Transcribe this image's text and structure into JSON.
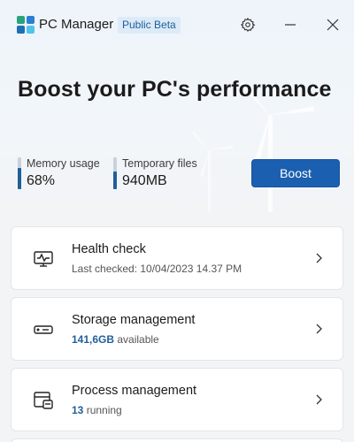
{
  "app": {
    "title": "PC Manager",
    "badge": "Public Beta"
  },
  "titlebar": {
    "settings_icon": "gear-icon",
    "minimize_icon": "minimize-icon",
    "close_icon": "close-icon"
  },
  "hero": {
    "headline": "Boost your PC's performance",
    "memory_label": "Memory usage",
    "memory_value": "68%",
    "memory_level": 0.68,
    "temp_label": "Temporary files",
    "temp_value": "940MB",
    "boost_label": "Boost"
  },
  "cards": [
    {
      "title": "Health check",
      "subtitle_prefix": "Last checked: 10/04/2023 14.37 PM",
      "highlight": "",
      "icon": "heartbeat-monitor-icon"
    },
    {
      "title": "Storage management",
      "highlight": "141,6GB",
      "subtitle_suffix": " available",
      "icon": "storage-drive-icon"
    },
    {
      "title": "Process management",
      "highlight": "13",
      "subtitle_suffix": " running",
      "icon": "process-window-icon"
    }
  ],
  "colors": {
    "accent": "#1b5fb0",
    "highlight_text": "#1f5f9a",
    "badge_bg": "#dcebf7"
  }
}
